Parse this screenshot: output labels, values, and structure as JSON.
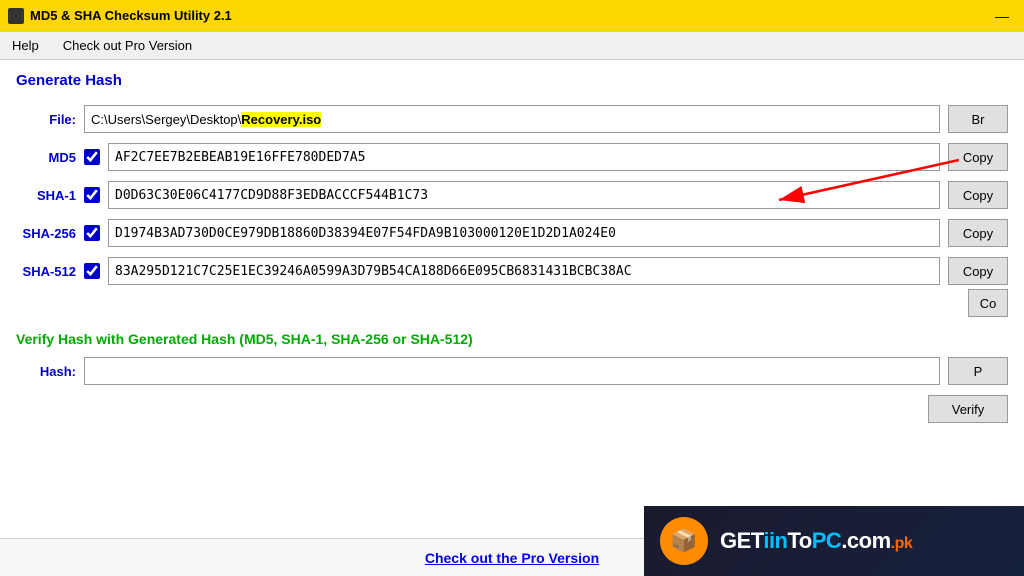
{
  "titleBar": {
    "title": "MD5 & SHA Checksum Utility 2.1",
    "minimizeBtn": "—"
  },
  "menuBar": {
    "items": [
      {
        "label": "Help"
      },
      {
        "label": "Check out Pro Version"
      }
    ]
  },
  "main": {
    "sectionTitle": "Generate Hash",
    "fileLabel": "File:",
    "filePathNormal": "C:\\Users\\Sergey\\Desktop\\",
    "filePathHighlight": "Recovery.iso",
    "browseBtn": "Br",
    "fields": [
      {
        "label": "MD5",
        "checked": true,
        "value": "AF2C7EE7B2EBEAB19E16FFE780DED7A5",
        "copyBtn": "Copy"
      },
      {
        "label": "SHA-1",
        "checked": true,
        "value": "D0D63C30E06C4177CD9D88F3EDBACCCF544B1C73",
        "copyBtn": "Copy"
      },
      {
        "label": "SHA-256",
        "checked": true,
        "value": "D1974B3AD730D0CE979DB18860D38394E07F54FDA9B103000120E1D2D1A024E0",
        "copyBtn": "Copy"
      },
      {
        "label": "SHA-512",
        "checked": true,
        "value": "83A295D121C7C25E1EC39246A0599A3D79B54CA188D66E095CB6831431BCBC38AC",
        "copyBtn": "Copy"
      }
    ],
    "coBtn": "Co",
    "verifySection": {
      "title": "Verify Hash with Generated Hash (MD5, SHA-1, SHA-256 or SHA-512)",
      "hashLabel": "Hash:",
      "hashPlaceholder": "",
      "pasteBtn": "P",
      "verifyBtn": "Verify"
    }
  },
  "bottomBar": {
    "proLink": "Check out the Pro Version"
  },
  "watermark": {
    "icon": "📦",
    "textGet": "GET",
    "textIin": "iin",
    "textTo": "To",
    "textPc": "PC",
    "textCom": ".com",
    "textPk": ".pk"
  }
}
